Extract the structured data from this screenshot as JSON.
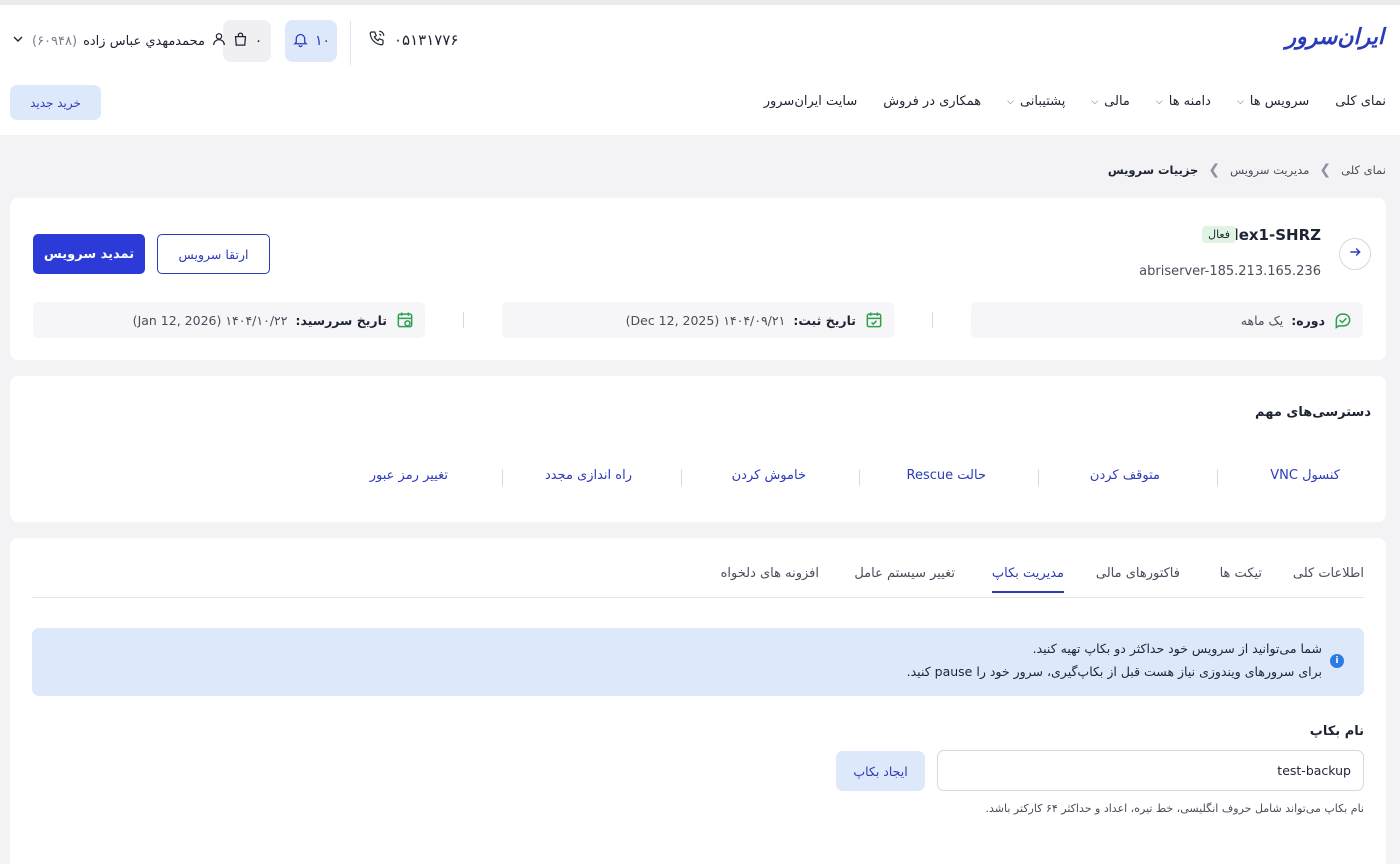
{
  "header": {
    "logo": "ایران‌سرور",
    "phone": "۰۵۱۳۱۷۷۶",
    "notifications_count": "۱۰",
    "cart_count": "۰",
    "user_name": "محمدمهدي عباس زاده",
    "user_id": "(۶۰۹۴۸)",
    "new_purchase": "خرید جدید"
  },
  "nav": {
    "items": [
      {
        "label": "نمای کلی"
      },
      {
        "label": "سرویس ها"
      },
      {
        "label": "دامنه ها"
      },
      {
        "label": "مالی"
      },
      {
        "label": "پشتیبانی"
      },
      {
        "label": "همکاری در فروش"
      },
      {
        "label": "سایت ایران‌سرور"
      }
    ]
  },
  "breadcrumb": {
    "items": [
      "نمای کلی",
      "مدیریت سرویس",
      "جزییات سرویس"
    ]
  },
  "service": {
    "name": "Flex1-SHRZ",
    "status": "فعال",
    "host": "abriserver-185.213.165.236",
    "renew_button": "تمدید سرویس",
    "upgrade_button": "ارتقا سرویس",
    "period_label": "دوره:",
    "period_value": "یک ماهه",
    "reg_label": "تاریخ ثبت:",
    "reg_value": "۱۴۰۴/۰۹/۲۱ (Dec 12, 2025)",
    "due_label": "تاریخ سررسید:",
    "due_value": "۱۴۰۴/۱۰/۲۲ (Jan 12, 2026)"
  },
  "quick_access": {
    "title": "دسترسی‌های مهم",
    "actions": [
      "کنسول VNC",
      "متوقف کردن",
      "حالت Rescue",
      "خاموش کردن",
      "راه اندازی مجدد",
      "تغییر رمز عبور"
    ]
  },
  "tabs": {
    "items": [
      "اطلاعات کلی",
      "تیکت ها",
      "فاکتورهای مالی",
      "مدیریت بکاپ",
      "تغییر سیستم عامل",
      "افزونه های دلخواه"
    ],
    "active": "مدیریت بکاپ"
  },
  "backup": {
    "alert_line1": "شما می‌توانید از سرویس خود حداکثر دو بکاپ تهیه کنید.",
    "alert_line2": "برای سرورهای ویندوزی نیاز هست قبل از بکاپ‌گیری، سرور خود را pause کنید.",
    "field_label": "نام بکاپ",
    "field_value": "test-backup",
    "create_button": "ایجاد بکاپ",
    "hint": "نام بکاپ می‌تواند شامل حروف انگلیسی، خط تیره، اعداد و حداکثر ۶۴ کارکتر باشد."
  },
  "colors": {
    "primary": "#2c3bd8",
    "primary_text": "#2c3bb8",
    "light_blue": "#dde8fb",
    "success": "#2e9e4f",
    "background": "#f3f3f5"
  }
}
